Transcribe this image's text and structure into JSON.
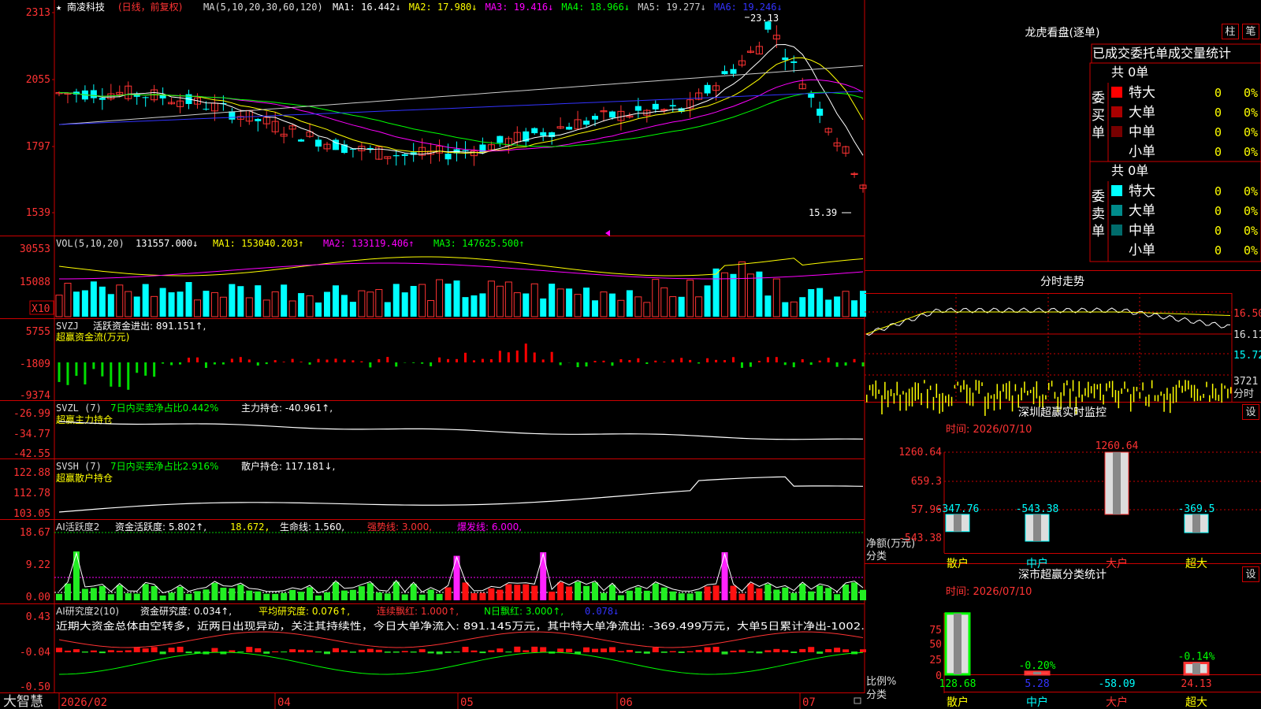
{
  "stock": {
    "name": "南凌科技",
    "period": "(日线，前复权)"
  },
  "ma_line": {
    "prefix": "MA(5,10,20,30,60,120)",
    "items": [
      {
        "label": "MA1: 16.442↓",
        "color": "#ffffff"
      },
      {
        "label": "MA2: 17.980↓",
        "color": "#ffff00"
      },
      {
        "label": "MA3: 19.416↓",
        "color": "#ff00ff"
      },
      {
        "label": "MA4: 18.966↓",
        "color": "#00ff00"
      },
      {
        "label": "MA5: 19.277↓",
        "color": "#cccccc"
      },
      {
        "label": "MA6: 19.246↓",
        "color": "#3333ff"
      }
    ]
  },
  "price_axis": [
    "2313",
    "2055",
    "1797",
    "1539"
  ],
  "price_marks": {
    "high": "23.13",
    "low": "15.39"
  },
  "vol": {
    "title": "VOL(5,10,20)",
    "value": "131557.000↓",
    "ma1": "MA1: 153040.203↑",
    "ma2": "MA2: 133119.406↑",
    "ma3": "MA3: 147625.500↑",
    "axis": [
      "30553",
      "15088"
    ],
    "unit": "X10"
  },
  "svzj": {
    "title": "SVZJ",
    "desc": "活跃资金进出: 891.151↑,",
    "sub": "超赢资金流(万元)",
    "axis": [
      "5755",
      "-1809",
      "-9374"
    ]
  },
  "svzl": {
    "title": "SVZL (7)",
    "desc1": "7日内买卖净占比0.442%",
    "desc2": "主力持仓: -40.961↑,",
    "sub": "超赢主力持仓",
    "axis": [
      "-26.99",
      "-34.77",
      "-42.55"
    ]
  },
  "svsh": {
    "title": "SVSH (7)",
    "desc1": "7日内买卖净占比2.916%",
    "desc2": "散户持仓: 117.181↓,",
    "sub": "超赢散户持仓",
    "axis": [
      "122.88",
      "112.78",
      "103.05"
    ]
  },
  "ai1": {
    "title": "AI活跃度2",
    "act": "资金活跃度: 5.802↑,",
    "v2": "18.672,",
    "life": "生命线: 1.560,",
    "strong": "强势线: 3.000,",
    "burst": "爆发线: 6.000,",
    "axis": [
      "18.67",
      "9.22",
      "0.00"
    ]
  },
  "ai2": {
    "title": "AI研究度2(10)",
    "res": "资金研究度: 0.034↑,",
    "avg": "平均研究度: 0.076↑,",
    "cont": "连续飘红: 1.000↑,",
    "nday": "N日飘红: 3.000↑,",
    "last": "0.078↓",
    "note": "近期大资金总体由空转多，近两日出现异动，关注其持续性，今日大单净流入: 891.145万元，其中特大单净流出: -369.499万元，大单5日累计净出-1002.",
    "axis": [
      "0.43",
      "-0.04",
      "-0.50"
    ]
  },
  "date_axis": [
    "2026/02",
    "04",
    "05",
    "06",
    "07"
  ],
  "brand": "大智慧",
  "lhb": {
    "title": "龙虎看盘(逐单)",
    "btn1": "柱",
    "btn2": "笔",
    "tabs": "已成交委托单成交量统计",
    "buy": {
      "side": "委买单",
      "count": "共 0单",
      "rows": [
        {
          "name": "特大",
          "qty": "0",
          "pct": "0%",
          "color": "#ff0000"
        },
        {
          "name": "大单",
          "qty": "0",
          "pct": "0%",
          "color": "#aa0000"
        },
        {
          "name": "中单",
          "qty": "0",
          "pct": "0%",
          "color": "#770000"
        },
        {
          "name": "小单",
          "qty": "0",
          "pct": "0%",
          "color": ""
        }
      ]
    },
    "sell": {
      "side": "委卖单",
      "count": "共 0单",
      "rows": [
        {
          "name": "特大",
          "qty": "0",
          "pct": "0%",
          "color": "#00ffff"
        },
        {
          "name": "大单",
          "qty": "0",
          "pct": "0%",
          "color": "#008b8b"
        },
        {
          "name": "中单",
          "qty": "0",
          "pct": "0%",
          "color": "#006b6b"
        },
        {
          "name": "小单",
          "qty": "0",
          "pct": "0%",
          "color": ""
        }
      ]
    }
  },
  "fenshi": {
    "title": "分时走势",
    "axis": [
      "16.50",
      "16.11",
      "15.72"
    ],
    "vol": "3721",
    "vol_unit": "分时"
  },
  "sz_monitor": {
    "title": "深圳超赢实时监控",
    "btn": "设",
    "date": "时间: 2026/07/10",
    "axis": [
      "1260.64",
      "659.3",
      "57.96",
      "-543.38"
    ],
    "ylabel": "净额(万元)",
    "xlabel": "分类",
    "chart_data": {
      "type": "bar",
      "categories": [
        "散户",
        "中户",
        "大户",
        "超大"
      ],
      "values": [
        -347.76,
        -543.38,
        1260.64,
        -369.5
      ],
      "ylim": [
        -543.38,
        1260.64
      ]
    }
  },
  "sz_class": {
    "title": "深市超赢分类统计",
    "btn": "设",
    "date": "时间: 2026/07/10",
    "axis": [
      "75",
      "50",
      "25",
      "0"
    ],
    "ylabel": "比例%",
    "xlabel": "分类",
    "chart_data": {
      "type": "bar",
      "categories": [
        "散户",
        "中户",
        "大户",
        "超大"
      ],
      "values": [
        128.68,
        5.28,
        -58.09,
        24.13
      ],
      "top_labels": [
        "",
        "-0.20%",
        "",
        "-0.14%"
      ]
    }
  }
}
